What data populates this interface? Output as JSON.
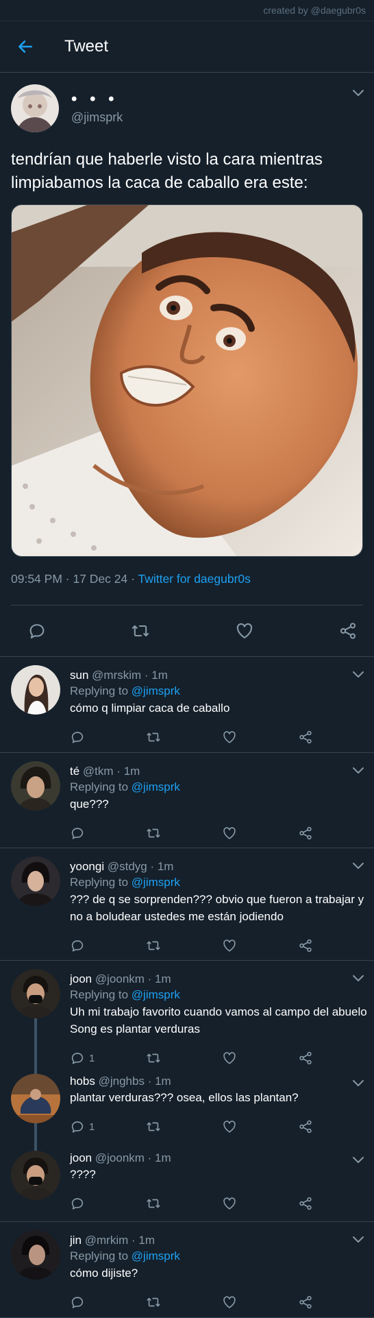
{
  "credit": "created by @daegubr0s",
  "header": {
    "title": "Tweet"
  },
  "tweet": {
    "name": "• • •",
    "handle": "@jimsprk",
    "text": "tendrían que haberle visto la cara mientras limpiabamos la caca de caballo era este:",
    "time": "09:54 PM",
    "date": "17 Dec 24",
    "source": "Twitter for daegubr0s"
  },
  "replies": [
    {
      "name": "sun",
      "handle": "@mrskim",
      "time": "1m",
      "replying_label": "Replying to",
      "replying_to": "@jimsprk",
      "text": "cómo q limpiar caca de caballo",
      "reply_count": ""
    },
    {
      "name": "té",
      "handle": "@tkm",
      "time": "1m",
      "replying_label": "Replying to",
      "replying_to": "@jimsprk",
      "text": "que???",
      "reply_count": ""
    },
    {
      "name": "yoongi",
      "handle": "@stdyg",
      "time": "1m",
      "replying_label": "Replying to",
      "replying_to": "@jimsprk",
      "text": "??? de q se sorprenden??? obvio que fueron a trabajar y no a boludear ustedes me están jodiendo",
      "reply_count": ""
    },
    {
      "name": "joon",
      "handle": "@joonkm",
      "time": "1m",
      "replying_label": "Replying to",
      "replying_to": "@jimsprk",
      "text": "Uh mi trabajo favorito cuando vamos al campo del abuelo Song es plantar verduras",
      "reply_count": "1"
    },
    {
      "name": "hobs",
      "handle": "@jnghbs",
      "time": "1m",
      "text": "plantar verduras??? osea, ellos las plantan?",
      "reply_count": "1"
    },
    {
      "name": "joon",
      "handle": "@joonkm",
      "time": "1m",
      "text": "????",
      "reply_count": ""
    },
    {
      "name": "jin",
      "handle": "@mrkim",
      "time": "1m",
      "replying_label": "Replying to",
      "replying_to": "@jimsprk",
      "text": "cómo dijiste?",
      "reply_count": ""
    }
  ],
  "colors": {
    "background": "#15202b",
    "accent": "#1da1f2",
    "muted": "#8899a6",
    "border": "#38444d"
  },
  "icons": [
    "back-arrow-icon",
    "chevron-down-icon",
    "reply-icon",
    "retweet-icon",
    "like-icon",
    "share-icon"
  ]
}
